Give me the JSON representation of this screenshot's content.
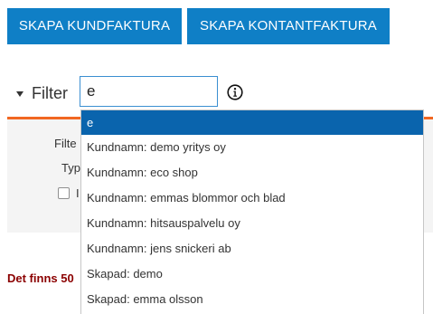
{
  "buttons": {
    "create_customer_invoice": "SKAPA KUNDFAKTURA",
    "create_cash_invoice": "SKAPA KONTANTFAKTURA"
  },
  "filter": {
    "toggle_label": "Filter",
    "search_value": "e",
    "info_icon": "info-circle-icon"
  },
  "background_form": {
    "filter_label_partial": "Filte",
    "type_label_partial": "Typ",
    "checkbox_label_partial": "I"
  },
  "result_count_partial": "Det finns 50",
  "autocomplete": {
    "items": [
      "e",
      "Kundnamn: demo yritys oy",
      "Kundnamn: eco shop",
      "Kundnamn: emmas blommor och blad",
      "Kundnamn: hitsauspalvelu oy",
      "Kundnamn: jens snickeri ab",
      "Skapad: demo",
      "Skapad: emma olsson"
    ],
    "selected_index": 0
  },
  "colors": {
    "button_bg": "#0f7fc6",
    "accent_line": "#f16722",
    "selected_item_bg": "#0a64ad",
    "count_text": "#8b0000"
  }
}
